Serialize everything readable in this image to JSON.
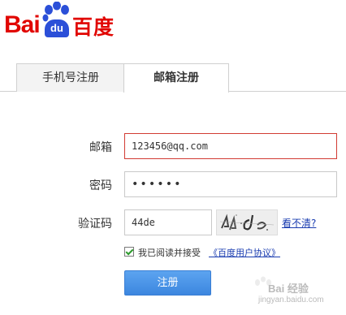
{
  "logo": {
    "text_left": "Bai",
    "text_paw": "du",
    "text_right": "百度"
  },
  "tabs": [
    {
      "label": "手机号注册",
      "active": false
    },
    {
      "label": "邮箱注册",
      "active": true
    }
  ],
  "form": {
    "email_label": "邮箱",
    "email_value": "123456@qq.com",
    "password_label": "密码",
    "password_value": "••••••",
    "captcha_label": "验证码",
    "captcha_value": "44de",
    "refresh_link": "看不清?",
    "agree_checked": true,
    "agree_text": "我已阅读并接受",
    "agree_link": "《百度用户协议》",
    "submit_label": "注册"
  },
  "watermark": {
    "text": "Bai 经验",
    "url": "jingyan.baidu.com"
  },
  "colors": {
    "brand_red": "#e10602",
    "brand_blue": "#2b4fd8",
    "button_blue": "#3c86df",
    "link_blue": "#1a3cb0",
    "error_border": "#d23b33"
  }
}
